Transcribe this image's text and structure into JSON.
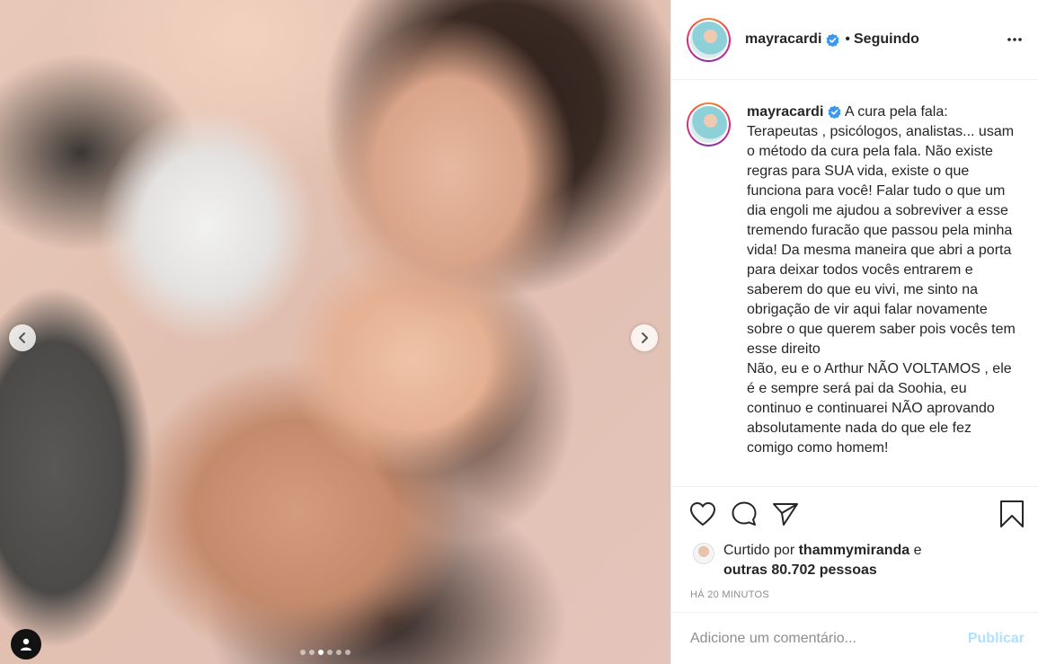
{
  "post": {
    "carousel_index": 3,
    "carousel_count": 6
  },
  "header": {
    "username": "mayracardi",
    "separator": "•",
    "following_label": "Seguindo",
    "more_icon": "more-horizontal-icon",
    "verified_color": "#3897f0"
  },
  "caption": {
    "username": "mayracardi",
    "text": " A cura pela fala:\nTerapeutas , psicólogos, analistas... usam o método da cura pela fala. Não existe regras para SUA vida, existe o que funciona para você! Falar tudo o que um dia engoli me ajudou a sobreviver a esse tremendo furacão que passou pela minha vida! Da mesma maneira que abri a porta para deixar todos vocês entrarem e saberem do que eu vivi, me sinto na obrigação de vir aqui falar novamente sobre o que querem saber pois vocês tem esse direito\nNão, eu e o Arthur NÃO VOLTAMOS , ele é e sempre será pai da Soohia, eu continuo e continuarei NÃO aprovando absolutamente nada do que ele fez comigo como homem!"
  },
  "likes": {
    "prefix": "Curtido por ",
    "liker": "thammymiranda",
    "connector": " e",
    "others": "outras 80.702 pessoas"
  },
  "timestamp": "HÁ 20 MINUTOS",
  "comment": {
    "placeholder": "Adicione um comentário...",
    "publish_label": "Publicar",
    "publish_color": "#b2dffc"
  }
}
